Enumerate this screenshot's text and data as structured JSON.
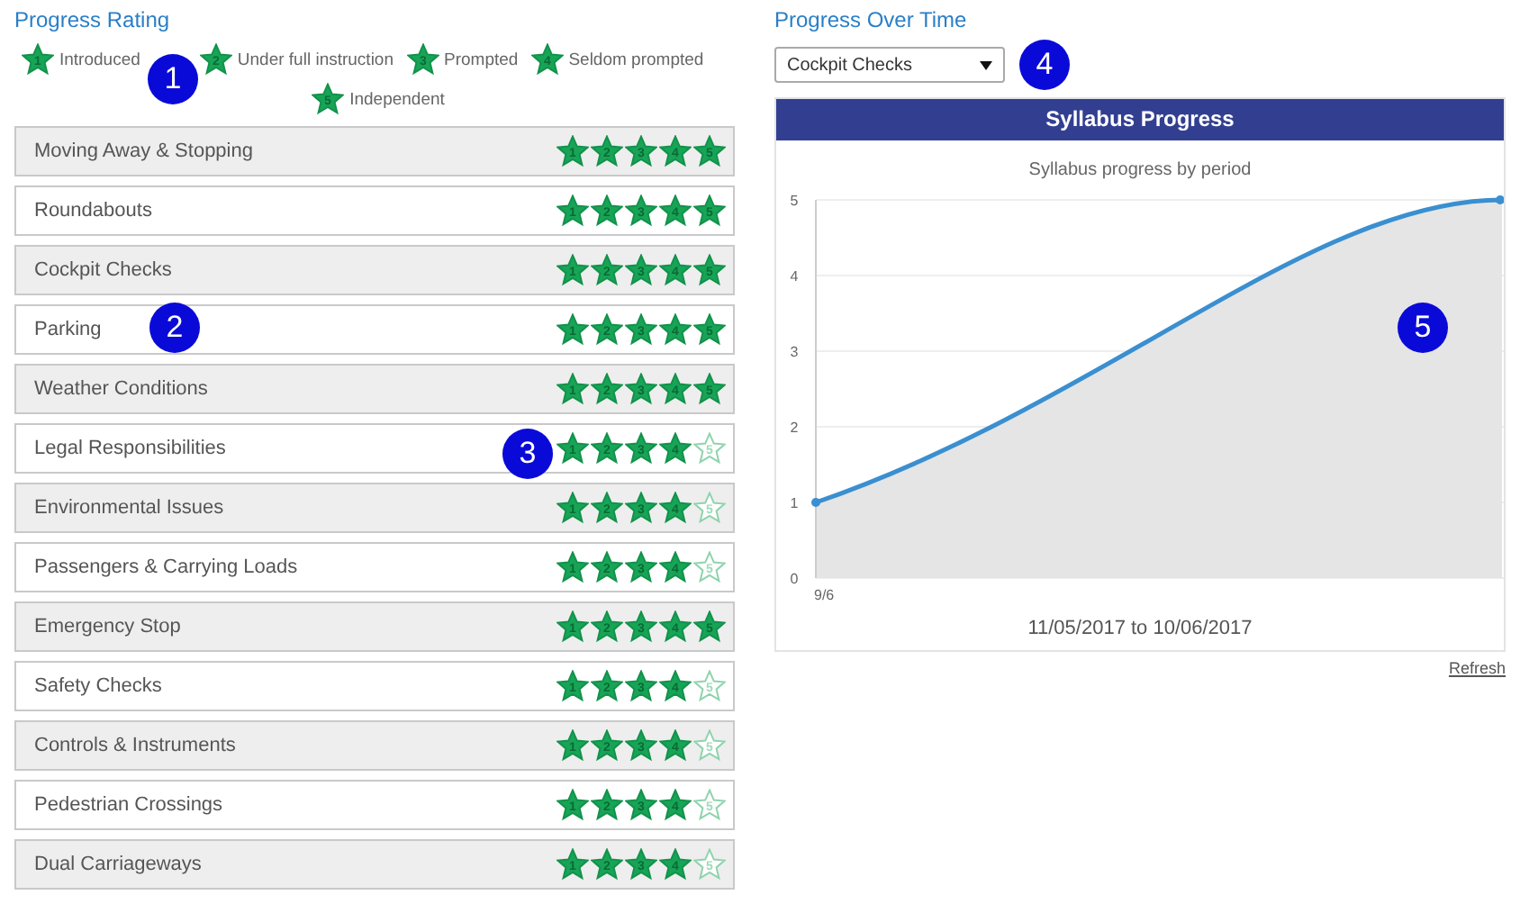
{
  "rating": {
    "heading": "Progress Rating",
    "legend": [
      {
        "number": "1",
        "label": "Introduced"
      },
      {
        "number": "2",
        "label": "Under full instruction"
      },
      {
        "number": "3",
        "label": "Prompted"
      },
      {
        "number": "4",
        "label": "Seldom prompted"
      },
      {
        "number": "5",
        "label": "Independent"
      }
    ],
    "skills": [
      {
        "name": "Moving Away & Stopping",
        "stars": 5,
        "star_numbers": [
          "1",
          "2",
          "3",
          "4",
          "5"
        ]
      },
      {
        "name": "Roundabouts",
        "stars": 5,
        "star_numbers": [
          "1",
          "2",
          "3",
          "4",
          "5"
        ]
      },
      {
        "name": "Cockpit Checks",
        "stars": 5,
        "star_numbers": [
          "1",
          "2",
          "3",
          "4",
          "5"
        ]
      },
      {
        "name": "Parking",
        "stars": 5,
        "star_numbers": [
          "1",
          "2",
          "3",
          "4",
          "5"
        ]
      },
      {
        "name": "Weather Conditions",
        "stars": 5,
        "star_numbers": [
          "1",
          "2",
          "3",
          "4",
          "5"
        ]
      },
      {
        "name": "Legal Responsibilities",
        "stars": 4,
        "star_numbers": [
          "1",
          "2",
          "3",
          "4",
          "5"
        ]
      },
      {
        "name": "Environmental Issues",
        "stars": 4,
        "star_numbers": [
          "1",
          "2",
          "3",
          "4",
          "5"
        ]
      },
      {
        "name": "Passengers & Carrying Loads",
        "stars": 4,
        "star_numbers": [
          "1",
          "2",
          "3",
          "4",
          "5"
        ]
      },
      {
        "name": "Emergency Stop",
        "stars": 5,
        "star_numbers": [
          "1",
          "2",
          "3",
          "4",
          "5"
        ]
      },
      {
        "name": "Safety Checks",
        "stars": 4,
        "star_numbers": [
          "1",
          "2",
          "3",
          "4",
          "5"
        ]
      },
      {
        "name": "Controls & Instruments",
        "stars": 4,
        "star_numbers": [
          "1",
          "2",
          "3",
          "4",
          "5"
        ]
      },
      {
        "name": "Pedestrian Crossings",
        "stars": 4,
        "star_numbers": [
          "1",
          "2",
          "3",
          "4",
          "5"
        ]
      },
      {
        "name": "Dual Carriageways",
        "stars": 4,
        "star_numbers": [
          "1",
          "2",
          "3",
          "4",
          "5"
        ]
      }
    ]
  },
  "progress": {
    "heading": "Progress Over Time",
    "select": {
      "value": "Cockpit Checks"
    },
    "chart": {
      "header": "Syllabus Progress",
      "title": "Syllabus progress by period",
      "range": "11/05/2017 to 10/06/2017",
      "y_labels": [
        "5",
        "4",
        "3",
        "2",
        "1",
        "0"
      ],
      "x_label": "9/6"
    },
    "refresh": "Refresh"
  },
  "callouts": [
    "1",
    "2",
    "3",
    "4",
    "5"
  ]
}
